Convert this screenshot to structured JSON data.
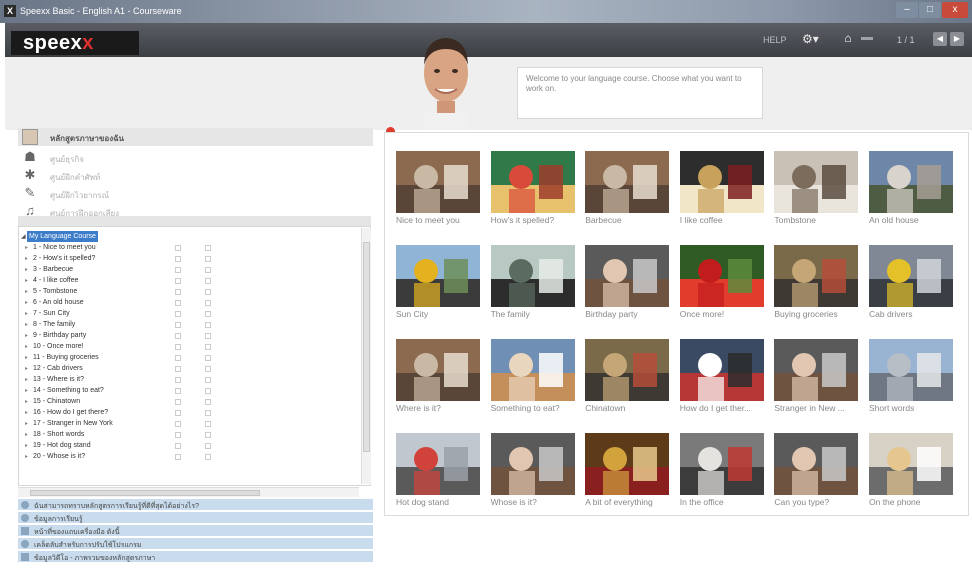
{
  "window": {
    "title": "Speexx Basic - English A1 - Courseware",
    "controls": {
      "minimize": "–",
      "maximize": "□",
      "close": "x"
    }
  },
  "appbar": {
    "logo_main": "speex",
    "logo_x": "x",
    "help": "HELP",
    "counter": "1 / 1"
  },
  "tutor": {
    "message": "Welcome to your language course. Choose what you want to work on."
  },
  "left_menu": {
    "home": "หลักสูตรภาษาของฉัน",
    "items": [
      {
        "label": "ศูนย์ธุรกิจ",
        "icon": "briefcase-icon"
      },
      {
        "label": "ศูนย์ฝึกคำศัพท์",
        "icon": "vocabulary-icon"
      },
      {
        "label": "ศูนย์ฝึกไวยากรณ์",
        "icon": "grammar-icon"
      },
      {
        "label": "ศูนย์การฝึกออกเสียง",
        "icon": "pronunciation-icon"
      }
    ]
  },
  "tree": {
    "root": "My Language Course",
    "lessons": [
      "1 - Nice to meet you",
      "2 - How's it spelled?",
      "3 - Barbecue",
      "4 - I like coffee",
      "5 - Tombstone",
      "6 - An old house",
      "7 - Sun City",
      "8 - The family",
      "9 - Birthday party",
      "10 - Once more!",
      "11 - Buying groceries",
      "12 - Cab drivers",
      "13 - Where is it?",
      "14 - Something to eat?",
      "15 - Chinatown",
      "16 - How do I get there?",
      "17 - Stranger in New York",
      "18 - Short words",
      "19 - Hot dog stand",
      "20 - Whose is it?"
    ]
  },
  "bottom_links": [
    "ฉันสามารถทราบหลักสูตรการเรียนรู้ที่ดีที่สุดได้อย่างไร?",
    "ข้อมูลการเรียนรู้",
    "หน้าที่ของแถบเครื่องมือ ดังนี้",
    "เคล็ดลับสำหรับการปรับใช้โปรแกรม",
    "ข้อมูลวิดีโอ - ภาพรวมของหลักสูตรภาษา"
  ],
  "lessons_grid": [
    {
      "caption": "Nice to meet you",
      "scene": "people"
    },
    {
      "caption": "How's it spelled?",
      "scene": "books"
    },
    {
      "caption": "Barbecue",
      "scene": "people"
    },
    {
      "caption": "I like coffee",
      "scene": "sign"
    },
    {
      "caption": "Tombstone",
      "scene": "building"
    },
    {
      "caption": "An old house",
      "scene": "house"
    },
    {
      "caption": "Sun City",
      "scene": "roadsign"
    },
    {
      "caption": "The family",
      "scene": "lake"
    },
    {
      "caption": "Birthday party",
      "scene": "person"
    },
    {
      "caption": "Once more!",
      "scene": "peppers"
    },
    {
      "caption": "Buying groceries",
      "scene": "market"
    },
    {
      "caption": "Cab drivers",
      "scene": "taxi"
    },
    {
      "caption": "Where is it?",
      "scene": "people"
    },
    {
      "caption": "Something to eat?",
      "scene": "cakes"
    },
    {
      "caption": "Chinatown",
      "scene": "market"
    },
    {
      "caption": "How do I get ther...",
      "scene": "streetsign"
    },
    {
      "caption": "Stranger in New ...",
      "scene": "person"
    },
    {
      "caption": "Short words",
      "scene": "bean"
    },
    {
      "caption": "Hot dog stand",
      "scene": "umbrella"
    },
    {
      "caption": "Whose is it?",
      "scene": "person"
    },
    {
      "caption": "A bit of everything",
      "scene": "food"
    },
    {
      "caption": "In the office",
      "scene": "office"
    },
    {
      "caption": "Can you type?",
      "scene": "person"
    },
    {
      "caption": "On the phone",
      "scene": "phone"
    }
  ],
  "colors": {
    "accent_red": "#e23a2c",
    "selection_blue": "#3d7cc9",
    "link_band": "#c9dced"
  }
}
